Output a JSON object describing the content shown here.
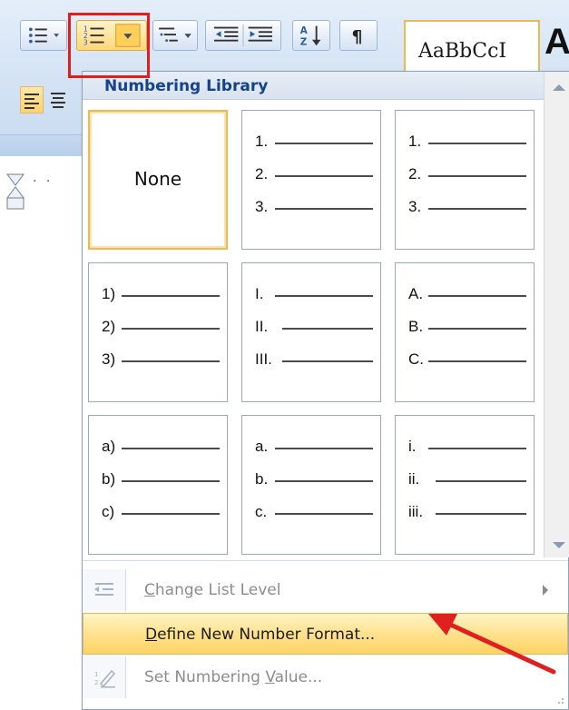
{
  "ribbon": {
    "style_preview": "AaBbCcI",
    "style_preview_next": "A"
  },
  "dropdown": {
    "section_title": "Numbering Library",
    "tiles": [
      {
        "type": "none",
        "label": "None",
        "selected": true
      },
      {
        "type": "list",
        "markers": [
          "1.",
          "2.",
          "3."
        ]
      },
      {
        "type": "list",
        "markers": [
          "1.",
          "2.",
          "3."
        ]
      },
      {
        "type": "list",
        "markers": [
          "1)",
          "2)",
          "3)"
        ]
      },
      {
        "type": "list",
        "markers": [
          "I.",
          "II.",
          "III."
        ]
      },
      {
        "type": "list",
        "markers": [
          "A.",
          "B.",
          "C."
        ]
      },
      {
        "type": "list",
        "markers": [
          "a)",
          "b)",
          "c)"
        ]
      },
      {
        "type": "list",
        "markers": [
          "a.",
          "b.",
          "c."
        ]
      },
      {
        "type": "list",
        "markers": [
          "i.",
          "ii.",
          "iii."
        ]
      }
    ],
    "menu": {
      "change_level": {
        "pre": "",
        "key": "C",
        "post": "hange List Level",
        "enabled": false
      },
      "define_format": {
        "pre": "",
        "key": "D",
        "post": "efine New Number Format...",
        "enabled": true
      },
      "set_value": {
        "pre": "Set Numbering ",
        "key": "V",
        "post": "alue...",
        "enabled": false
      }
    }
  },
  "colors": {
    "header_text": "#15428b",
    "highlight_box": "#e21d1d",
    "hover_fill": "#ffd363",
    "selected_tile_border": "#f2b84b"
  },
  "icons": [
    "bullets-icon",
    "numbering-icon",
    "multilevel-list-icon",
    "decrease-indent-icon",
    "increase-indent-icon",
    "sort-icon",
    "show-formatting-marks-icon",
    "change-list-level-icon",
    "set-numbering-value-icon"
  ]
}
